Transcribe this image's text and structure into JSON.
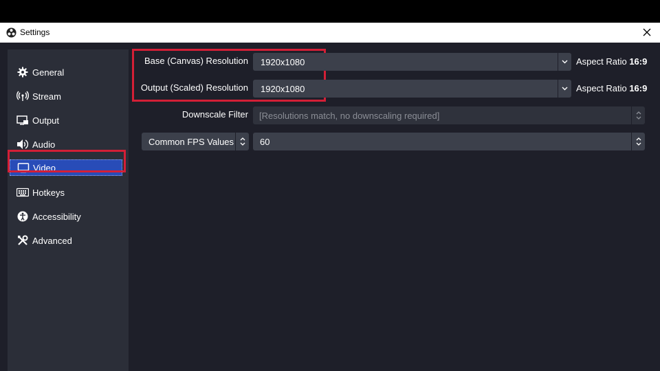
{
  "window": {
    "title": "Settings"
  },
  "sidebar": {
    "items": [
      {
        "label": "General",
        "icon": "gear-icon"
      },
      {
        "label": "Stream",
        "icon": "broadcast-icon"
      },
      {
        "label": "Output",
        "icon": "output-icon"
      },
      {
        "label": "Audio",
        "icon": "speaker-icon"
      },
      {
        "label": "Video",
        "icon": "monitor-icon",
        "selected": true
      },
      {
        "label": "Hotkeys",
        "icon": "keyboard-icon"
      },
      {
        "label": "Accessibility",
        "icon": "accessibility-icon"
      },
      {
        "label": "Advanced",
        "icon": "tools-icon"
      }
    ]
  },
  "video": {
    "base_resolution_label": "Base (Canvas) Resolution",
    "base_resolution_value": "1920x1080",
    "output_resolution_label": "Output (Scaled) Resolution",
    "output_resolution_value": "1920x1080",
    "aspect_prefix": "Aspect Ratio",
    "base_aspect": "16:9",
    "output_aspect": "16:9",
    "downscale_label": "Downscale Filter",
    "downscale_value": "[Resolutions match, no downscaling required]",
    "fps_type": "Common FPS Values",
    "fps_value": "60"
  },
  "colors": {
    "highlight": "#d41f36",
    "selected": "#284cb8",
    "background": "#1e1f29",
    "panel": "#2b2e38",
    "field": "#3c404b"
  }
}
